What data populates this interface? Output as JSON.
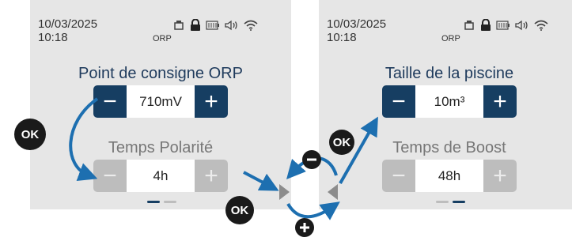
{
  "screen_left": {
    "date": "10/03/2025",
    "time": "10:18",
    "mode": "ORP",
    "status_icons": [
      "usb-icon",
      "lock-icon",
      "battery-icon",
      "speaker-icon",
      "wifi-icon"
    ],
    "setting1": {
      "title": "Point de consigne ORP",
      "value": "710mV",
      "minus": "−",
      "plus": "+"
    },
    "setting2": {
      "title": "Temps Polarité",
      "value": "4h",
      "minus": "−",
      "plus": "+"
    },
    "page_indicator": {
      "pages": 2,
      "active": 1
    }
  },
  "screen_right": {
    "date": "10/03/2025",
    "time": "10:18",
    "mode": "ORP",
    "status_icons": [
      "usb-icon",
      "lock-icon",
      "battery-icon",
      "speaker-icon",
      "wifi-icon"
    ],
    "setting1": {
      "title": "Taille de la piscine",
      "value": "10m³",
      "minus": "−",
      "plus": "+"
    },
    "setting2": {
      "title": "Temps de Boost",
      "value": "48h",
      "minus": "−",
      "plus": "+"
    },
    "page_indicator": {
      "pages": 2,
      "active": 2
    }
  },
  "overlay": {
    "ok_label": "OK",
    "colors": {
      "arrow": "#1d6fb0",
      "button_dark": "#163e62",
      "button_disabled": "#bdbdbd",
      "screen_bg": "#e6e6e6"
    }
  }
}
